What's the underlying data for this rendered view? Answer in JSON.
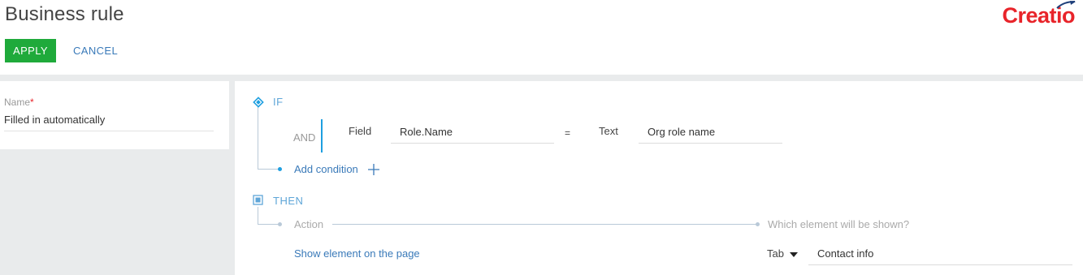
{
  "page": {
    "title": "Business rule",
    "logo": "Creatio"
  },
  "toolbar": {
    "apply_label": "APPLY",
    "cancel_label": "CANCEL"
  },
  "name_field": {
    "label": "Name",
    "required_mark": "*",
    "value": "Filled in automatically"
  },
  "rule": {
    "if_label": "IF",
    "and_label": "AND",
    "condition": {
      "left_type": "Field",
      "left_value": "Role.Name",
      "operator": "=",
      "right_type": "Text",
      "right_value": "Org role name"
    },
    "add_condition_label": "Add condition",
    "then_label": "THEN",
    "action_placeholder": "Action",
    "element_placeholder": "Which element will be shown?",
    "action_value": "Show element on the page",
    "element_type": "Tab",
    "element_value": "Contact info"
  },
  "icons": {
    "if": "diamond-icon",
    "then": "square-icon",
    "add": "plus-icon",
    "dropdown": "caret-down-icon",
    "logo_mark": "logo-swoosh-icon"
  },
  "colors": {
    "apply": "#1faa3b",
    "link": "#3a7ab9",
    "accent": "#1e9fe0",
    "logo": "#e8242a",
    "required": "#e8242a"
  }
}
